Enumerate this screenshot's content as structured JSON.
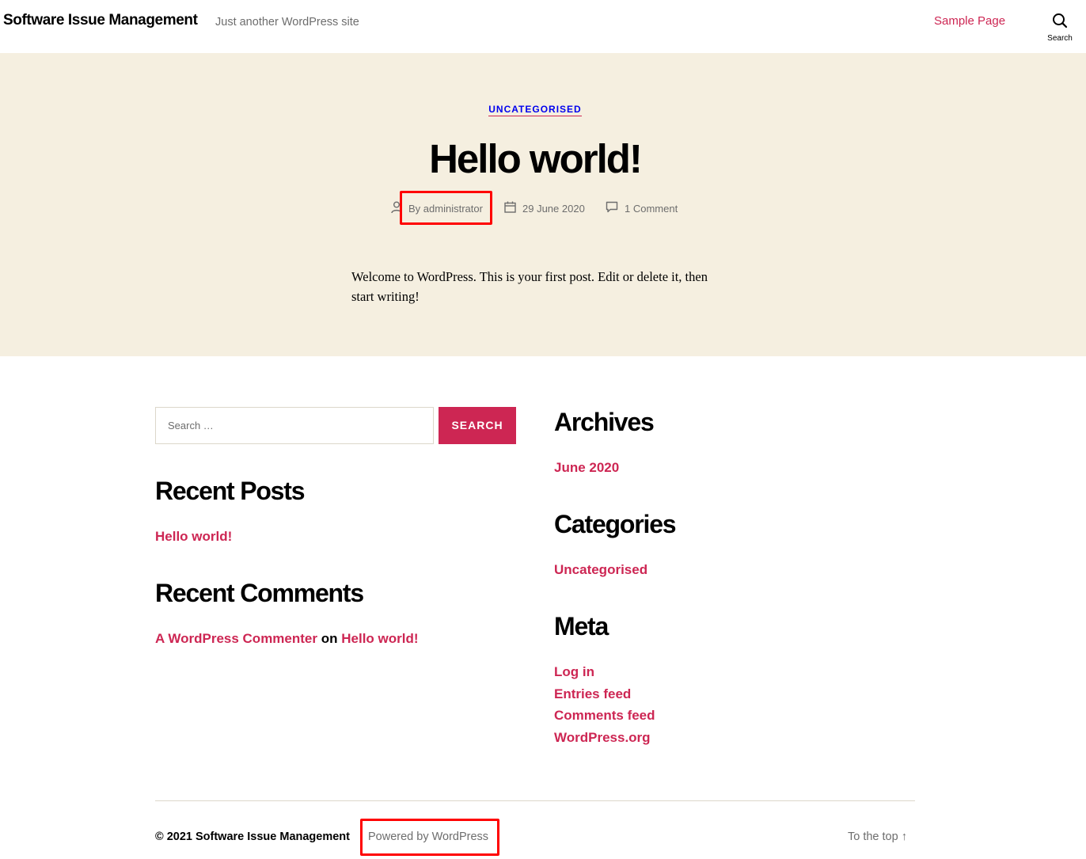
{
  "header": {
    "site_title": "Software Issue Management",
    "site_description": "Just another WordPress site",
    "nav_link": "Sample Page",
    "search_toggle_label": "Search"
  },
  "post": {
    "category": "UNCATEGORISED",
    "title": "Hello world!",
    "author": "By administrator",
    "date": "29 June 2020",
    "comments": "1 Comment",
    "content": "Welcome to WordPress. This is your first post. Edit or delete it, then start writing!"
  },
  "search": {
    "placeholder": "Search …",
    "button_label": "SEARCH"
  },
  "widgets": {
    "recent_posts_title": "Recent Posts",
    "recent_posts": [
      "Hello world!"
    ],
    "recent_comments_title": "Recent Comments",
    "recent_comment": {
      "author": "A WordPress Commenter",
      "connector": "on",
      "post": "Hello world!"
    },
    "archives_title": "Archives",
    "archives": [
      "June 2020"
    ],
    "categories_title": "Categories",
    "categories": [
      "Uncategorised"
    ],
    "meta_title": "Meta",
    "meta_links": [
      "Log in",
      "Entries feed",
      "Comments feed",
      "WordPress.org"
    ]
  },
  "footer": {
    "copyright": "© 2021 Software Issue Management",
    "powered_by": "Powered by WordPress",
    "to_top": "To the top ↑"
  },
  "colors": {
    "accent": "#cd2653",
    "hero_background": "#f5efe0",
    "highlight_box": "#ff0000"
  },
  "icons": {
    "search_toggle": "search-icon",
    "author": "user-icon",
    "date": "calendar-icon",
    "comments": "comment-bubble-icon"
  }
}
